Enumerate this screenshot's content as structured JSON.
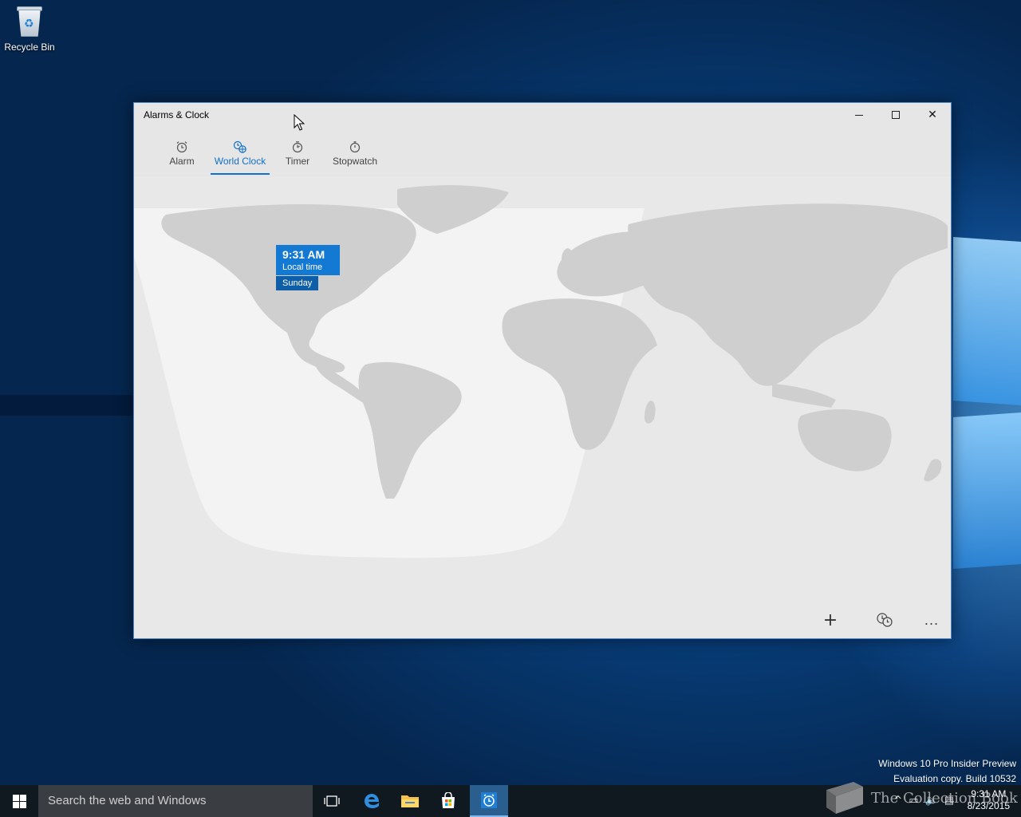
{
  "desktop": {
    "icons": [
      {
        "label": "Recycle Bin",
        "icon": "recycle-bin-icon"
      }
    ],
    "watermark": {
      "line1": "Windows 10 Pro Insider Preview",
      "line2": "Evaluation copy. Build 10532"
    },
    "overlay_text": "The Collection Book"
  },
  "window": {
    "title": "Alarms & Clock",
    "caption_buttons": [
      "minimize",
      "maximize",
      "close"
    ],
    "tabs": [
      {
        "label": "Alarm",
        "icon": "alarm-clock-icon",
        "active": false
      },
      {
        "label": "World Clock",
        "icon": "globe-clock-icon",
        "active": true
      },
      {
        "label": "Timer",
        "icon": "timer-icon",
        "active": false
      },
      {
        "label": "Stopwatch",
        "icon": "stopwatch-icon",
        "active": false
      }
    ],
    "accent": "#1170c8",
    "local_time_card": {
      "time": "9:31 AM",
      "subtitle": "Local time",
      "day": "Sunday"
    },
    "bottom_actions": [
      {
        "label": "+",
        "icon": "add-icon"
      },
      {
        "label": "",
        "icon": "compare-clocks-icon"
      },
      {
        "label": "...",
        "icon": "more-icon"
      }
    ]
  },
  "taskbar": {
    "search_placeholder": "Search the web and Windows",
    "pinned": [
      "task-view-icon",
      "edge-icon",
      "file-explorer-icon",
      "store-icon",
      "alarms-clock-icon"
    ],
    "clock_time": "9:31 AM",
    "clock_date": "8/23/2015"
  }
}
